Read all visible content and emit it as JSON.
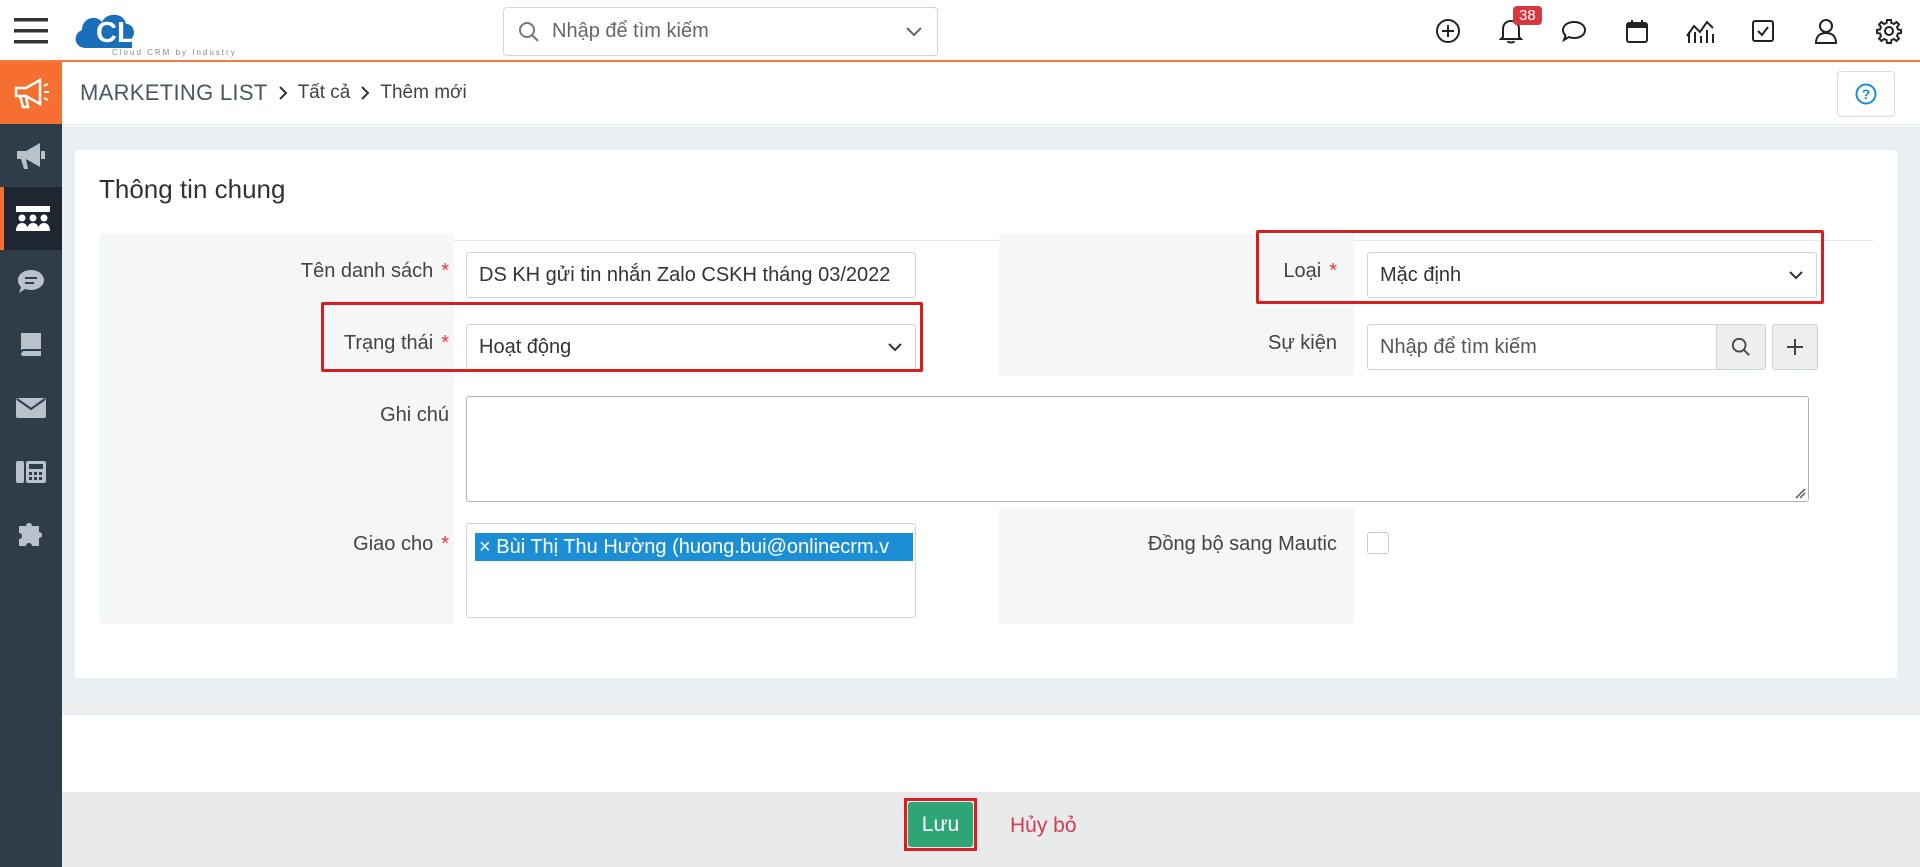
{
  "app": {
    "logo_text": "CLOUDPRO",
    "logo_tagline": "Cloud CRM by Industry",
    "notification_count": "38",
    "brand_color": "#f46f30"
  },
  "search": {
    "placeholder": "Nhập để tìm kiếm"
  },
  "breadcrumb": {
    "module": "MARKETING LIST",
    "level1": "Tất cả",
    "level2": "Thêm mới"
  },
  "form": {
    "section_title": "Thông tin chung",
    "list_name": {
      "label": "Tên danh sách",
      "value": "DS KH gửi tin nhắn Zalo CSKH tháng 03/2022"
    },
    "type": {
      "label": "Loại",
      "value": "Mặc định"
    },
    "status": {
      "label": "Trạng thái",
      "value": "Hoạt động"
    },
    "event": {
      "label": "Sự kiện",
      "placeholder": "Nhập để tìm kiếm"
    },
    "note": {
      "label": "Ghi chú",
      "value": ""
    },
    "assignee": {
      "label": "Giao cho",
      "tag": "× Bùi Thị Thu Hường (huong.bui@onlinecrm.v"
    },
    "sync": {
      "label": "Đồng bộ sang Mautic",
      "checked": false
    }
  },
  "footer": {
    "save_label": "Lưu",
    "cancel_label": "Hủy bỏ"
  }
}
